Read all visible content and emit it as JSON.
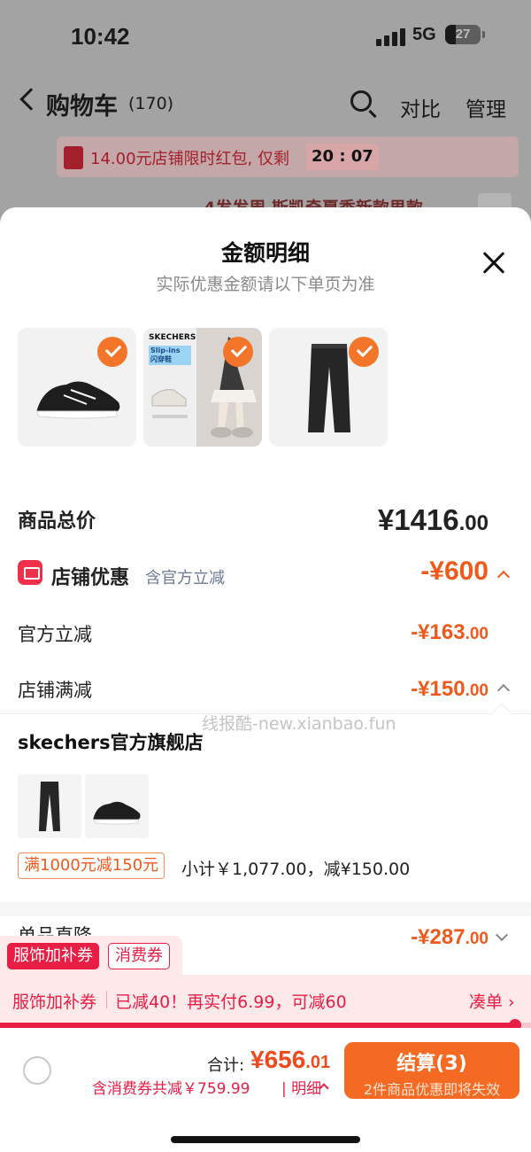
{
  "status_bar": {
    "time": "10:42",
    "network": "5G",
    "battery": "27"
  },
  "background_page": {
    "title": "购物车",
    "count": "(170)",
    "compare": "对比",
    "manage": "管理",
    "promo_text": "14.00元店铺限时红包, 仅剩",
    "promo_timer": "20 : 07",
    "peek_text": "4发发周 斯凯奇夏季新款男款"
  },
  "sheet": {
    "title": "金额明细",
    "subtitle": "实际优惠金额请以下单页为准",
    "products": [
      {
        "name": "black-sneaker"
      },
      {
        "name": "skechers-slip-ins",
        "brand_text": "SKECHERS",
        "badge_text": "Slip-ins 闪穿鞋"
      },
      {
        "name": "black-pants"
      }
    ],
    "goods_total_label": "商品总价",
    "goods_total": "¥1416",
    "goods_total_decimal": ".00",
    "store_discount_label": "店铺优惠",
    "store_discount_note": "含官方立减",
    "store_discount_value": "-¥600",
    "official_cut_label": "官方立减",
    "official_cut_value": "-¥163",
    "official_cut_decimal": ".00",
    "store_full_cut_label": "店铺满减",
    "store_full_cut_value": "-¥150",
    "store_full_cut_decimal": ".00",
    "watermark": "线报酷-new.xianbao.fun",
    "store": {
      "name": "skechers官方旗舰店",
      "tag": "满1000元减150元",
      "subtotal": "小计￥1,077.00，减¥150.00"
    },
    "single_drop_label": "单品直降",
    "single_drop_value": "-¥287",
    "single_drop_decimal": ".00"
  },
  "coupon": {
    "pill_red": "服饰加补券",
    "pill_outline": "消费券",
    "strip_title": "服饰加补券",
    "strip_text": "已减40！再实付6.99，可减60",
    "strip_link": "凑单 ›",
    "progress": 0.97
  },
  "bottom": {
    "total_label": "合计:",
    "total_value": "¥656",
    "total_decimal": ".01",
    "discount_line": "含消费券共减￥759.99",
    "detail_link": "明细",
    "checkout": "结算(3)",
    "checkout_sub": "2件商品优惠即将失效"
  },
  "colors": {
    "accent": "#ee5a1c",
    "coupon_red": "#e81e45",
    "checkout": "#f56a22"
  }
}
